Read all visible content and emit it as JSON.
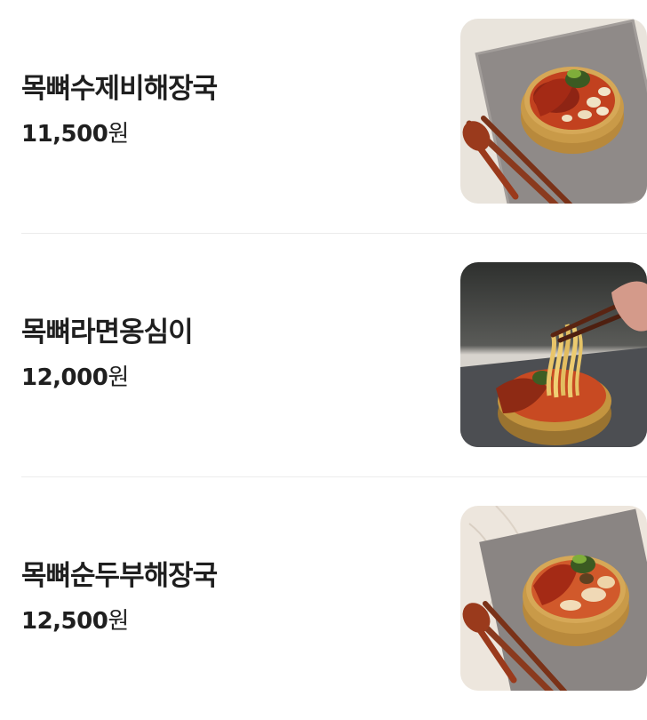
{
  "menu": {
    "items": [
      {
        "name": "목뼈수제비해장국",
        "price": "11,500",
        "currency": "원",
        "image_icon": "food-photo-sujebi-haejangguk"
      },
      {
        "name": "목뼈라면옹심이",
        "price": "12,000",
        "currency": "원",
        "image_icon": "food-photo-ramyeon-ongsimi"
      },
      {
        "name": "목뼈순두부해장국",
        "price": "12,500",
        "currency": "원",
        "image_icon": "food-photo-sundubu-haejangguk"
      }
    ]
  },
  "colors": {
    "text": "#1f1f1f",
    "divider": "#ececec",
    "background": "#ffffff"
  }
}
